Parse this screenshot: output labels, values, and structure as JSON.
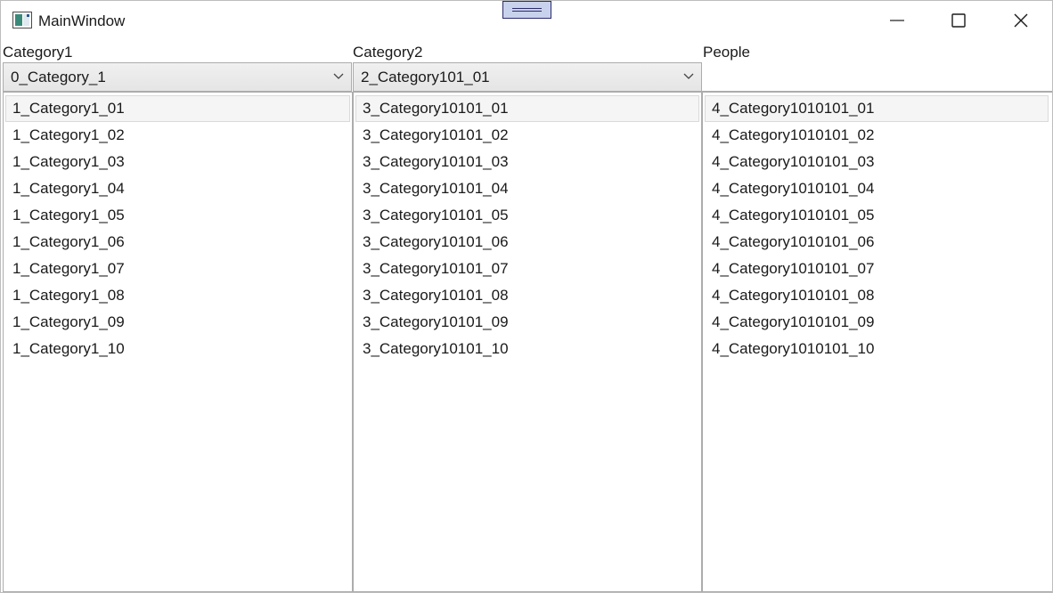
{
  "window": {
    "title": "MainWindow"
  },
  "icons": {
    "app": "app-window-icon",
    "minimize": "minimize-icon",
    "maximize": "maximize-icon",
    "close": "close-icon",
    "dropdown": "chevron-down-icon"
  },
  "columns": [
    {
      "label": "Category1",
      "selected_value": "0_Category_1",
      "items": [
        "1_Category1_01",
        "1_Category1_02",
        "1_Category1_03",
        "1_Category1_04",
        "1_Category1_05",
        "1_Category1_06",
        "1_Category1_07",
        "1_Category1_08",
        "1_Category1_09",
        "1_Category1_10"
      ]
    },
    {
      "label": "Category2",
      "selected_value": "2_Category101_01",
      "items": [
        "3_Category10101_01",
        "3_Category10101_02",
        "3_Category10101_03",
        "3_Category10101_04",
        "3_Category10101_05",
        "3_Category10101_06",
        "3_Category10101_07",
        "3_Category10101_08",
        "3_Category10101_09",
        "3_Category10101_10"
      ]
    },
    {
      "label": "People",
      "selected_value": "",
      "items": [
        "4_Category1010101_01",
        "4_Category1010101_02",
        "4_Category1010101_03",
        "4_Category1010101_04",
        "4_Category1010101_05",
        "4_Category1010101_06",
        "4_Category1010101_07",
        "4_Category1010101_08",
        "4_Category1010101_09",
        "4_Category1010101_10"
      ]
    }
  ]
}
